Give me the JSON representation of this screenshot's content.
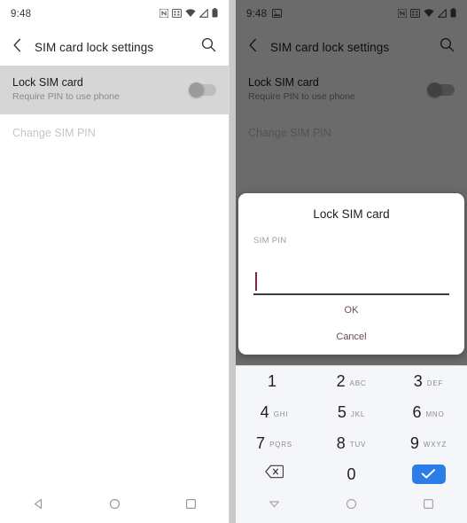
{
  "left_phone": {
    "status_bar": {
      "time": "9:48",
      "icons": [
        "nfc-icon",
        "vibrate-icon",
        "wifi-icon",
        "signal-icon",
        "battery-icon"
      ]
    },
    "app_bar": {
      "back_icon": "chevron-left-icon",
      "title": "SIM card lock settings",
      "search_icon": "search-icon"
    },
    "rows": [
      {
        "title": "Lock SIM card",
        "subtitle": "Require PIN to use phone",
        "toggle": "off",
        "highlighted": true
      },
      {
        "title": "Change SIM PIN",
        "subtitle": "",
        "disabled": true
      }
    ],
    "nav_bar": {
      "back": "triangle-back-icon",
      "home": "circle-home-icon",
      "recents": "square-recents-icon"
    }
  },
  "right_phone": {
    "status_bar": {
      "time": "9:48",
      "left_icons": [
        "screenshot-image-icon"
      ],
      "icons": [
        "nfc-icon",
        "vibrate-icon",
        "wifi-icon",
        "signal-icon",
        "battery-icon"
      ]
    },
    "app_bar": {
      "back_icon": "chevron-left-icon",
      "title": "SIM card lock settings",
      "search_icon": "search-icon"
    },
    "rows": [
      {
        "title": "Lock SIM card",
        "subtitle": "Require PIN to use phone",
        "toggle": "off",
        "highlighted": false
      },
      {
        "title": "Change SIM PIN",
        "subtitle": "",
        "disabled": true
      }
    ],
    "dialog": {
      "title": "Lock SIM card",
      "field_label": "SIM PIN",
      "field_value": "",
      "ok_label": "OK",
      "cancel_label": "Cancel"
    },
    "keypad": {
      "keys": [
        {
          "digit": "1",
          "letters": ""
        },
        {
          "digit": "2",
          "letters": "ABC"
        },
        {
          "digit": "3",
          "letters": "DEF"
        },
        {
          "digit": "4",
          "letters": "GHI"
        },
        {
          "digit": "5",
          "letters": "JKL"
        },
        {
          "digit": "6",
          "letters": "MNO"
        },
        {
          "digit": "7",
          "letters": "PQRS"
        },
        {
          "digit": "8",
          "letters": "TUV"
        },
        {
          "digit": "9",
          "letters": "WXYZ"
        }
      ],
      "backspace_icon": "backspace-icon",
      "zero": {
        "digit": "0",
        "letters": ""
      },
      "enter_icon": "check-enter-icon",
      "enter_color": "#2b7de9"
    },
    "nav_bar": {
      "hide_keyboard": "chevron-down-nav-icon",
      "home": "circle-home-icon",
      "recents": "square-recents-icon"
    }
  },
  "colors": {
    "accent_blue": "#2b7de9",
    "highlight_row": "#d6d6d6",
    "scrim": "rgba(0,0,0,0.58)",
    "caret": "#7a2b38",
    "dialog_button_text": "#6b4d58"
  }
}
